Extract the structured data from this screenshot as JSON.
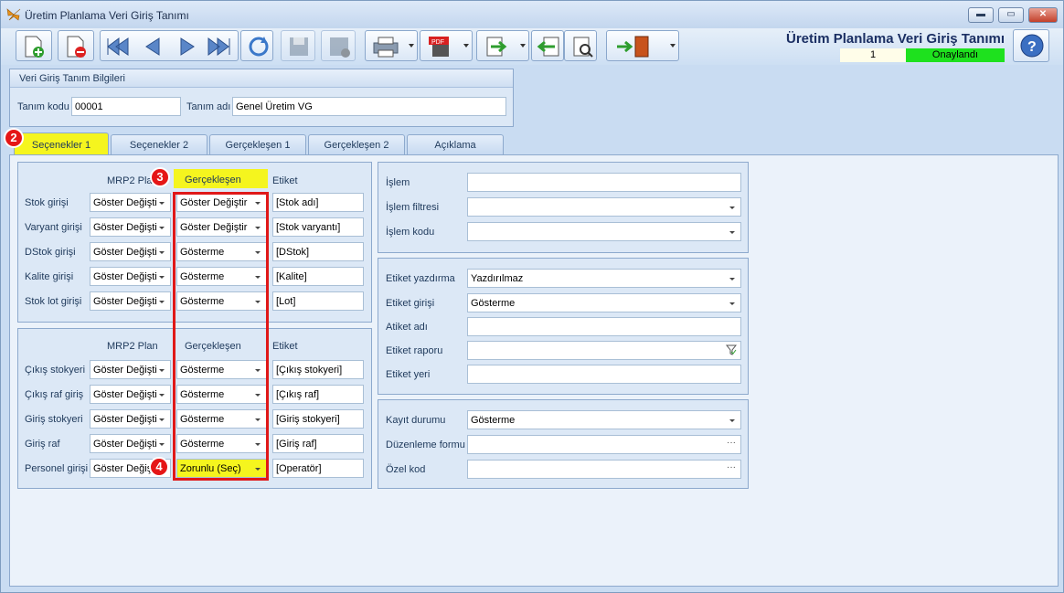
{
  "window": {
    "title": "Üretim Planlama Veri Giriş Tanımı",
    "min": "▬",
    "max": "▭",
    "close": "✕"
  },
  "header": {
    "title": "Üretim Planlama Veri Giriş Tanımı",
    "record_no": "1",
    "status": "Onaylandı",
    "status_color": "#1ee11e"
  },
  "info": {
    "group_title": "Veri Giriş Tanım Bilgileri",
    "code_label": "Tanım kodu",
    "code_value": "00001",
    "name_label": "Tanım adı",
    "name_value": "Genel Üretim VG"
  },
  "tabs": [
    "Seçenekler 1",
    "Seçenekler 2",
    "Gerçekleşen 1",
    "Gerçekleşen 2",
    "Açıklama"
  ],
  "badges": [
    "2",
    "3",
    "4"
  ],
  "section1": {
    "col_mrp": "MRP2 Plan",
    "col_gercek": "Gerçekleşen",
    "col_etiket": "Etiket",
    "rows": [
      {
        "label": "Stok girişi",
        "mrp": "Göster Değişti",
        "gercek": "Göster Değiştir",
        "etiket": "[Stok adı]"
      },
      {
        "label": "Varyant girişi",
        "mrp": "Göster Değişti",
        "gercek": "Göster Değiştir",
        "etiket": "[Stok varyantı]"
      },
      {
        "label": "DStok girişi",
        "mrp": "Göster Değişti",
        "gercek": "Gösterme",
        "etiket": "[DStok]"
      },
      {
        "label": "Kalite girişi",
        "mrp": "Göster Değişti",
        "gercek": "Gösterme",
        "etiket": "[Kalite]"
      },
      {
        "label": "Stok lot girişi",
        "mrp": "Göster Değişti",
        "gercek": "Gösterme",
        "etiket": "[Lot]"
      }
    ]
  },
  "section2": {
    "col_mrp": "MRP2 Plan",
    "col_gercek": "Gerçekleşen",
    "col_etiket": "Etiket",
    "rows": [
      {
        "label": "Çıkış stokyeri",
        "mrp": "Göster Değişti",
        "gercek": "Gösterme",
        "etiket": "[Çıkış stokyeri]"
      },
      {
        "label": "Çıkış raf giriş",
        "mrp": "Göster Değişti",
        "gercek": "Gösterme",
        "etiket": "[Çıkış raf]"
      },
      {
        "label": "Giriş stokyeri",
        "mrp": "Göster Değişti",
        "gercek": "Gösterme",
        "etiket": "[Giriş stokyeri]"
      },
      {
        "label": "Giriş raf",
        "mrp": "Göster Değişti",
        "gercek": "Gösterme",
        "etiket": "[Giriş raf]"
      },
      {
        "label": "Personel girişi",
        "mrp": "Göster Değiş",
        "gercek": "Zorunlu (Seç)",
        "etiket": "[Operatör]"
      }
    ]
  },
  "right1": {
    "islem": "İşlem",
    "islem_filtresi": "İşlem filtresi",
    "islem_kodu": "İşlem kodu"
  },
  "right2": {
    "etiket_yazdirma": "Etiket yazdırma",
    "etiket_yazdirma_val": "Yazdırılmaz",
    "etiket_girisi": "Etiket girişi",
    "etiket_girisi_val": "Gösterme",
    "atiket_adi": "Atiket adı",
    "etiket_raporu": "Etiket raporu",
    "etiket_yeri": "Etiket yeri"
  },
  "right3": {
    "kayit_durumu": "Kayıt durumu",
    "kayit_durumu_val": "Gösterme",
    "duzenleme_formu": "Düzenleme formu",
    "ozel_kod": "Özel kod"
  },
  "ellipsis": "···"
}
